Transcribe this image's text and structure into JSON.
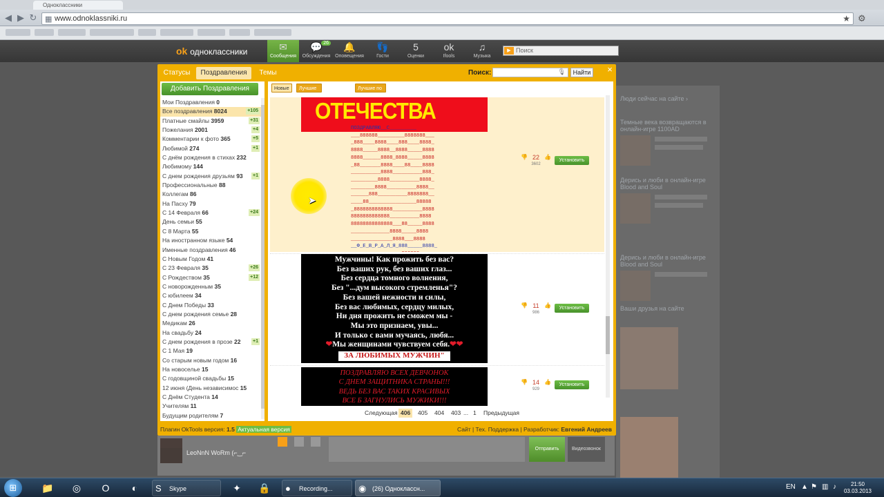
{
  "browser": {
    "tab_title": "Одноклассники",
    "url": "www.odnoklassniki.ru"
  },
  "site": {
    "logo_text": "одноклассники",
    "nav": [
      {
        "label": "Сообщения",
        "icon": "✉",
        "name": "nav-messages",
        "active": true
      },
      {
        "label": "Обсуждения",
        "icon": "💬",
        "name": "nav-discussions",
        "badge": "26"
      },
      {
        "label": "Оповещения",
        "icon": "🔔",
        "name": "nav-notifications"
      },
      {
        "label": "Гости",
        "icon": "👣",
        "name": "nav-guests"
      },
      {
        "label": "Оценки",
        "icon": "5",
        "name": "nav-ratings"
      },
      {
        "label": "Ifools",
        "icon": "ok",
        "name": "nav-ifools"
      },
      {
        "label": "Музыка",
        "icon": "♫",
        "name": "nav-music"
      }
    ],
    "search_placeholder": "Поиск"
  },
  "modal": {
    "tabs": [
      {
        "label": "Статусы"
      },
      {
        "label": "Поздравления",
        "active": true
      },
      {
        "label": "Темы"
      }
    ],
    "search_label": "Поиск:",
    "search_button": "Найти",
    "close": "×",
    "add_button": "Добавить Поздравления",
    "filters": [
      "Новые",
      "Лучшие по рейтингу",
      "Лучшие по установкам"
    ],
    "categories": [
      {
        "name": "Мои Поздравления",
        "count": "0"
      },
      {
        "name": "Все поздравления",
        "count": "8024",
        "plus": "+105",
        "active": true
      },
      {
        "name": "Платные смайлы",
        "count": "3959",
        "plus": "+31"
      },
      {
        "name": "Пожелания",
        "count": "2001",
        "plus": "+4"
      },
      {
        "name": "Комментарии к фото",
        "count": "365",
        "plus": "+5"
      },
      {
        "name": "Любимой",
        "count": "274",
        "plus": "+1"
      },
      {
        "name": "С днём рождения в стихах",
        "count": "232"
      },
      {
        "name": "Любимому",
        "count": "144"
      },
      {
        "name": "С днем рождения друзьям",
        "count": "93",
        "plus": "+1"
      },
      {
        "name": "Профессиональные",
        "count": "88"
      },
      {
        "name": "Коллегам",
        "count": "86"
      },
      {
        "name": "На Пасху",
        "count": "79"
      },
      {
        "name": "С 14 Февраля",
        "count": "66",
        "plus": "+24"
      },
      {
        "name": "День семьи",
        "count": "55"
      },
      {
        "name": "С 8 Марта",
        "count": "55"
      },
      {
        "name": "На иностранном языке",
        "count": "54"
      },
      {
        "name": "Именные поздравления",
        "count": "46"
      },
      {
        "name": "С Новым Годом",
        "count": "41"
      },
      {
        "name": "С 23 Февраля",
        "count": "35",
        "plus": "+26"
      },
      {
        "name": "С Рождеством",
        "count": "35",
        "plus": "+12"
      },
      {
        "name": "С новорожденным",
        "count": "35"
      },
      {
        "name": "С юбилеем",
        "count": "34"
      },
      {
        "name": "С Днем Победы",
        "count": "33"
      },
      {
        "name": "С днем рождения семье",
        "count": "28"
      },
      {
        "name": "Медикам",
        "count": "26"
      },
      {
        "name": "На свадьбу",
        "count": "24"
      },
      {
        "name": "С днем рождения в прозе",
        "count": "22",
        "plus": "+1"
      },
      {
        "name": "С 1 Мая",
        "count": "19"
      },
      {
        "name": "Со старым новым годом",
        "count": "16"
      },
      {
        "name": "На новоселье",
        "count": "15"
      },
      {
        "name": "С годовщиной свадьбы",
        "count": "15"
      },
      {
        "name": "12 июня (День независимос",
        "count": "15"
      },
      {
        "name": "С Днём Студента",
        "count": "14"
      },
      {
        "name": "Учителям",
        "count": "11"
      },
      {
        "name": "Будущим родителям",
        "count": "7"
      }
    ],
    "cards": [
      {
        "title": "ОТЕЧЕСТВА",
        "ascii_top": "ПОЗДРАВЛЯЮ__С_________",
        "ascii_lines": [
          "___888888_________8888888___",
          "_888____8888____888____8888_",
          "8888_____8888__8888_____8888",
          "8888______8888_8888_____8888",
          "_88_______8888____88____8888",
          "__________8888__________888_",
          "_________8888__________8888_",
          "________8888__________8888__",
          "______888__________8888888__",
          "____88________________88888",
          "_8888888888888__________8888",
          "8888888888888__________8888",
          "88888888888888___88_____8888",
          "_____________8888_____8888",
          "______________8888___8888"
        ],
        "ascii_bottom": "__Ф_Е_В_Р_А_Л_Я_888_____8888_",
        "ascii_last": "_________________888888___",
        "score": "22",
        "installs": "3602",
        "button": "Установить"
      },
      {
        "poem": [
          "Мужчины! Как прожить без вас?",
          "Без ваших рук, без ваших глаз...",
          "Без сердца томного волнения,",
          "Без \"...дум высокого стремленья\"?",
          "Без вашей нежности и силы,",
          "Без вас любимых, сердцу милых,",
          "Ни дня прожить не сможем мы -",
          "Мы это признаем, увы...",
          "И только с вами мучаясь, любя...",
          "Мы женщинами чувствуем себя."
        ],
        "last_line": "ЗА  ЛЮБИМЫХ МУЖЧИН\"",
        "score": "11",
        "installs": "986",
        "button": "Установить"
      },
      {
        "lines": [
          "ПОЗДРАВЛЯЮ ВСЕХ ДЕВЧОНОК",
          "С ДНЕМ ЗАЩИТНИКА СТРАНЫ!!!",
          "ВЕДЬ БЕЗ ВАС ТАКИХ КРАСИВЫХ",
          "ВСЕ Б ЗАГНУЛИСЬ МУЖИКИ!!!"
        ],
        "score": "14",
        "installs": "929",
        "button": "Установить"
      }
    ],
    "pager": {
      "next": "Следующая",
      "pages": [
        "406",
        "405",
        "404",
        "403",
        "...",
        "1"
      ],
      "current": "406",
      "prev": "Предыдущая"
    },
    "footer": {
      "plugin": "Плагин OkTools версия:",
      "version": "1.5",
      "actual": "Актуальная версия",
      "links": "Сайт | Тех. Поддержка | Разработчик:",
      "developer": "Евгений Андреев"
    }
  },
  "below": {
    "chat_name": "LeoNnN WoRm (⌐‿⌐",
    "send": "Отправить",
    "video": "Видеозвонок"
  },
  "right_sidebar": {
    "items": [
      "Темные века возвращаются в онлайн-игре 1100AD",
      "Дерись и люби в онлайн-игре Blood and Soul",
      "Дерись и люби в онлайн-игре Blood and Soul"
    ],
    "friends_header": "Ваши друзья на сайте"
  },
  "taskbar": {
    "tasks": [
      {
        "label": "Skype",
        "icon": "S"
      },
      {
        "label": "Recording...",
        "icon": "●"
      },
      {
        "label": "(26) Одноклассн...",
        "icon": "◉",
        "active": true
      }
    ],
    "lang": "EN",
    "time": "21:50",
    "date": "03.03.2013"
  }
}
